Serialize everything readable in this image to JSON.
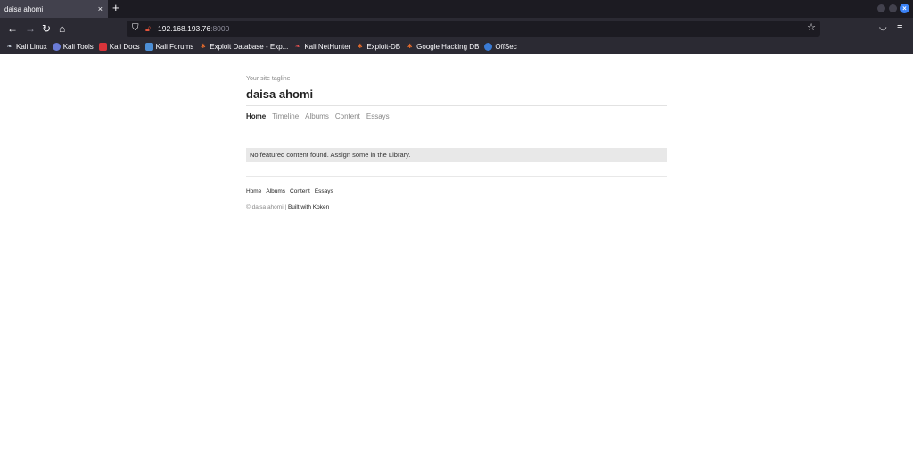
{
  "browser": {
    "tab": {
      "title": "daisa ahomi",
      "close_icon": "×"
    },
    "new_tab_icon": "+",
    "url": {
      "host": "192.168.193.76",
      "port": ":8000"
    },
    "bookmarks": [
      {
        "label": "Kali Linux",
        "icon": "kali-dragon-icon"
      },
      {
        "label": "Kali Tools",
        "icon": "kali-tools-icon"
      },
      {
        "label": "Kali Docs",
        "icon": "kali-docs-icon"
      },
      {
        "label": "Kali Forums",
        "icon": "kali-forums-icon"
      },
      {
        "label": "Exploit Database - Exp...",
        "icon": "exploit-db-icon"
      },
      {
        "label": "Kali NetHunter",
        "icon": "nethunter-icon"
      },
      {
        "label": "Exploit-DB",
        "icon": "exploit-db-icon"
      },
      {
        "label": "Google Hacking DB",
        "icon": "exploit-db-icon"
      },
      {
        "label": "OffSec",
        "icon": "offsec-icon"
      }
    ]
  },
  "site": {
    "tagline": "Your site tagline",
    "title": "daisa ahomi",
    "nav": [
      "Home",
      "Timeline",
      "Albums",
      "Content",
      "Essays"
    ],
    "nav_active": "Home",
    "notice": "No featured content found. Assign some in the Library.",
    "footer_nav": [
      "Home",
      "Albums",
      "Content",
      "Essays"
    ],
    "copyright_prefix": "© daisa ahomi |",
    "built_with": "Built with Koken"
  },
  "colors": {
    "chrome_dark": "#1c1b22",
    "chrome": "#2b2a33",
    "tab_active": "#42414d",
    "notice_bg": "#e8e8e8",
    "muted_text": "#888888"
  }
}
